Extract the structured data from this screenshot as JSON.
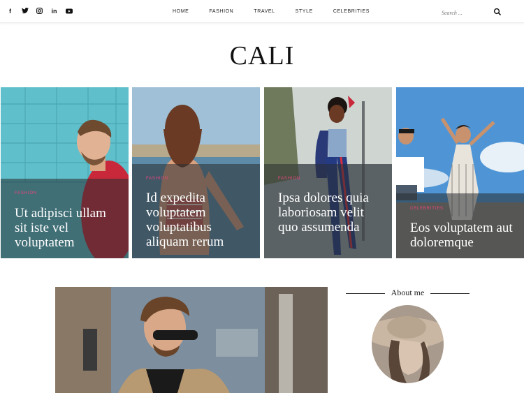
{
  "header": {
    "social_icons": [
      "facebook-icon",
      "twitter-icon",
      "instagram-icon",
      "linkedin-icon",
      "youtube-icon"
    ],
    "nav": [
      "HOME",
      "FASHION",
      "TRAVEL",
      "STYLE",
      "CELEBRITIES"
    ],
    "search_placeholder": "Search ..."
  },
  "site": {
    "logo": "CALI"
  },
  "cards": [
    {
      "category": "FASHION",
      "title": "Ut adipisci ullam sit iste vel voluptatem"
    },
    {
      "category": "FASHION",
      "title": "Id expedita voluptatem voluptatibus aliquam rerum"
    },
    {
      "category": "FASHION",
      "title": "Ipsa dolores quia laboriosam velit quo assumenda"
    },
    {
      "category": "CELEBRITIES",
      "title": "Eos voluptatem aut doloremque"
    }
  ],
  "sidebar": {
    "about_title": "About me"
  },
  "colors": {
    "accent": "#e8467c",
    "overlay": "#2d3237",
    "text": "#111111"
  }
}
